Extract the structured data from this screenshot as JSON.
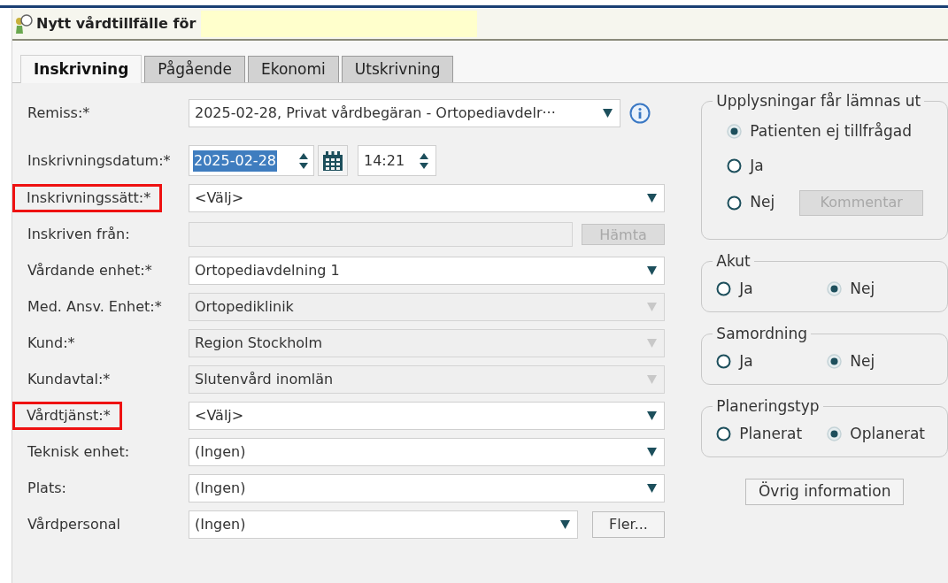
{
  "window": {
    "title": "Nytt vårdtillfälle för"
  },
  "tabs": [
    {
      "label": "Inskrivning",
      "selected": true
    },
    {
      "label": "Pågående",
      "selected": false
    },
    {
      "label": "Ekonomi",
      "selected": false
    },
    {
      "label": "Utskrivning",
      "selected": false
    }
  ],
  "form": {
    "rows": [
      {
        "label": "Remiss:*",
        "kind": "select_info",
        "value": "2025-02-28, Privat vårdbegäran  - Ortopediavdelr···",
        "disabled": false,
        "highlighted": false
      },
      {
        "label": "Inskrivningsdatum:*",
        "kind": "datetime",
        "date": "2025-02-28",
        "time": "14:21",
        "highlighted": false
      },
      {
        "label": "Inskrivningssätt:*",
        "kind": "select",
        "value": "<Välj>",
        "disabled": false,
        "highlighted": true
      },
      {
        "label": "Inskriven från:",
        "kind": "text_button",
        "button": {
          "label": "Hämta",
          "disabled": true
        },
        "disabled": true,
        "highlighted": false
      },
      {
        "label": "Vårdande enhet:*",
        "kind": "select",
        "value": "Ortopediavdelning 1",
        "disabled": false,
        "highlighted": false
      },
      {
        "label": "Med. Ansv. Enhet:*",
        "kind": "select",
        "value": "Ortopediklinik",
        "disabled": true,
        "highlighted": false
      },
      {
        "label": "Kund:*",
        "kind": "select",
        "value": "Region Stockholm",
        "disabled": true,
        "highlighted": false
      },
      {
        "label": "Kundavtal:*",
        "kind": "select",
        "value": "Slutenvård inomlän",
        "disabled": true,
        "highlighted": false
      },
      {
        "label": "Vårdtjänst:*",
        "kind": "select",
        "value": "<Välj>",
        "disabled": false,
        "highlighted": true
      },
      {
        "label": "Teknisk enhet:",
        "kind": "select",
        "value": "(Ingen)",
        "disabled": false,
        "highlighted": false
      },
      {
        "label": "Plats:",
        "kind": "select",
        "value": "(Ingen)",
        "disabled": false,
        "highlighted": false
      },
      {
        "label": "Vårdpersonal",
        "kind": "select_button",
        "value": "(Ingen)",
        "disabled": false,
        "button": {
          "label": "Fler...",
          "disabled": false
        },
        "highlighted": false
      }
    ]
  },
  "groups": [
    {
      "title": "Upplysningar får lämnas ut",
      "kind": "column",
      "options": [
        {
          "label": "Patienten ej tillfrågad",
          "selected": true
        },
        {
          "label": "Ja",
          "selected": false
        },
        {
          "label": "Nej",
          "selected": false
        }
      ],
      "button": {
        "label": "Kommentar",
        "disabled": true
      }
    },
    {
      "title": "Akut",
      "kind": "row",
      "options": [
        {
          "label": "Ja",
          "selected": false
        },
        {
          "label": "Nej",
          "selected": true
        }
      ]
    },
    {
      "title": "Samordning",
      "kind": "row",
      "options": [
        {
          "label": "Ja",
          "selected": false
        },
        {
          "label": "Nej",
          "selected": true
        }
      ]
    },
    {
      "title": "Planeringstyp",
      "kind": "row",
      "options": [
        {
          "label": "Planerat",
          "selected": false
        },
        {
          "label": "Oplanerat",
          "selected": true
        }
      ]
    }
  ],
  "extra_button": {
    "label": "Övrig information"
  }
}
